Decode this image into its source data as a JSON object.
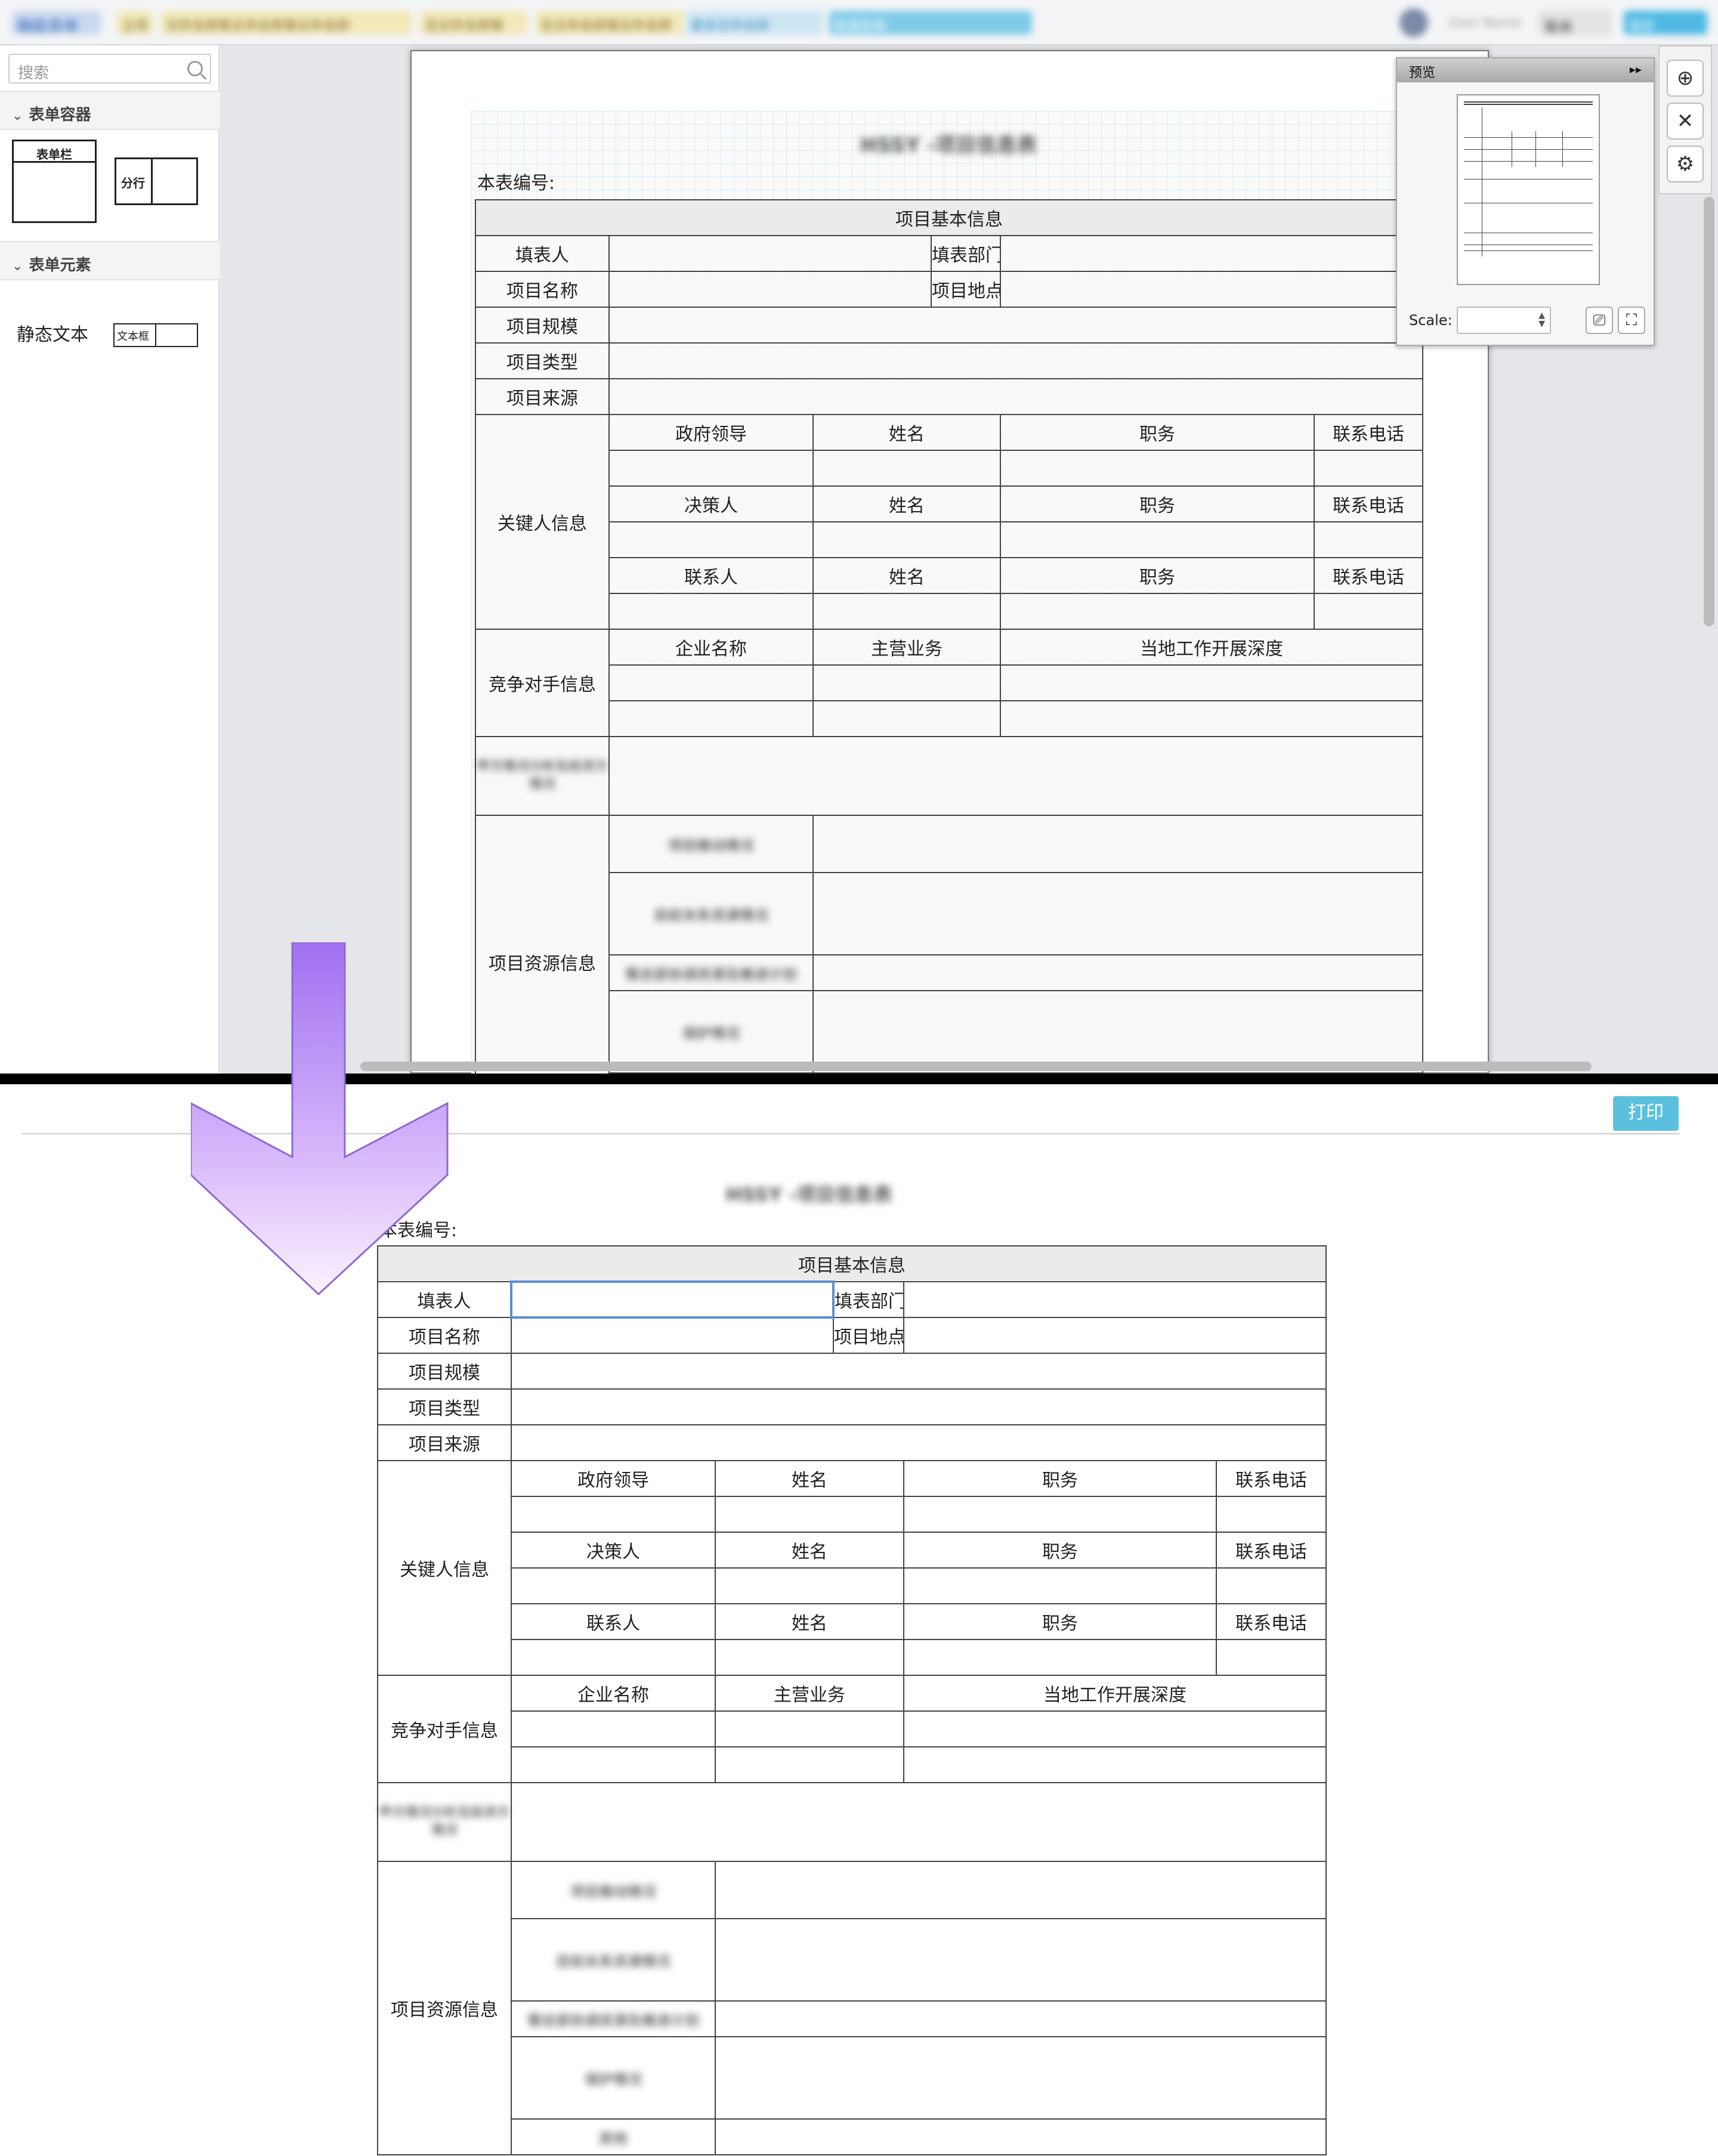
{
  "topbar": {
    "logo_text": "确能表单",
    "tabs": [
      "立项",
      "文件名称等文件名称等文件名称",
      "无文件名称等",
      "无文件名称等文件名称",
      "更多文件名称",
      "新建表单"
    ],
    "user": "User Name",
    "btn_outline": "取消",
    "btn_primary": "保存"
  },
  "sidebar": {
    "search_placeholder": "搜索",
    "sections": [
      {
        "title": "表单容器",
        "items": [
          "表单栏",
          "分行"
        ]
      },
      {
        "title": "表单元素",
        "items": [
          "静态文本",
          "文本框"
        ]
      }
    ]
  },
  "preview_panel": {
    "title": "预览",
    "scale_label": "Scale:",
    "scale_value": ""
  },
  "toolbar": {
    "icons": [
      "target-icon",
      "tools-icon",
      "gear-icon"
    ]
  },
  "form": {
    "title": "HSSY -项目信息表",
    "number_label": "本表编号:",
    "section_title": "项目基本信息",
    "basic": {
      "filler": "填表人",
      "dept": "填表部门",
      "proj_name": "项目名称",
      "proj_place": "项目地点",
      "proj_scale": "项目规模",
      "proj_type": "项目类型",
      "proj_source": "项目来源"
    },
    "key_person": {
      "label": "关键人信息",
      "groups": [
        "政府领导",
        "决策人",
        "联系人"
      ],
      "name": "姓名",
      "title": "职务",
      "phone": "联系电话"
    },
    "competitor": {
      "label": "竞争对手信息",
      "company": "企业名称",
      "business": "主营业务",
      "depth": "当地工作开展深度"
    },
    "blurred_label": "甲方情况分析及投资方情况",
    "resource": {
      "label": "项目资源信息",
      "rows": [
        "项目推动情况",
        "目前关系资源情况",
        "需总部协调资源及推进计划",
        "保护情况",
        "其他"
      ]
    }
  },
  "print_label": "打印"
}
